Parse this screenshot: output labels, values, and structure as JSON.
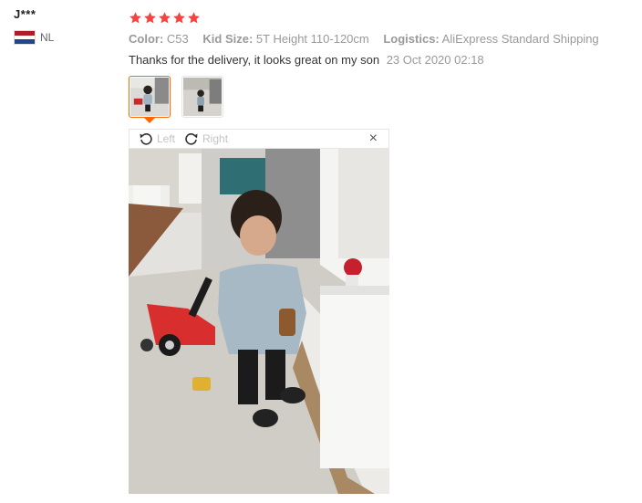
{
  "reviewer": {
    "name": "J***",
    "country_code": "NL",
    "flag_icon": "flag-netherlands-icon"
  },
  "rating": {
    "stars": 5,
    "max": 5,
    "color": "#f5443c"
  },
  "specs": {
    "color_label": "Color:",
    "color_value": "C53",
    "size_label": "Kid Size:",
    "size_value": "5T Height 110-120cm",
    "logistics_label": "Logistics:",
    "logistics_value": "AliExpress Standard Shipping"
  },
  "review": {
    "text": "Thanks for the delivery, it looks great on my son",
    "date": "23 Oct 2020 02:18"
  },
  "images": {
    "thumbnails": 2,
    "selected_index": 0
  },
  "viewer": {
    "rotate_left_label": "Left",
    "rotate_right_label": "Right",
    "close_label": "×"
  },
  "colors": {
    "accent": "#ff6600",
    "muted_text": "#999999"
  }
}
